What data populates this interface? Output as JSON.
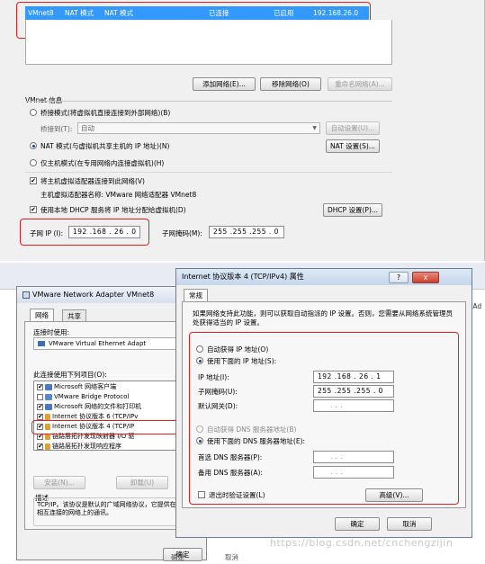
{
  "network_row": {
    "name": "VMnet8",
    "type": "NAT 模式",
    "external": "NAT 模式",
    "host_conn": "已连接",
    "dhcp": "已启用",
    "subnet": "192.168.26.0"
  },
  "network_buttons": {
    "add": "添加网络(E)...",
    "remove": "移除网络(O)",
    "rename": "重命名网络(A)..."
  },
  "vmnet_info": {
    "title": "VMnet 信息",
    "bridged_label": "桥接模式(将虚拟机直接连接到外部网络)(B)",
    "bridged_to_label": "桥接到(T):",
    "bridged_to_value": "自动",
    "auto_settings": "自动设置(U)...",
    "nat_label": "NAT 模式(与虚拟机共享主机的 IP 地址)(N)",
    "nat_settings": "NAT 设置(S)...",
    "hostonly_label": "仅主机模式(在专用网络内连接虚拟机)(H)",
    "connect_host_adapter": "将主机虚拟适配器连接到此网络(V)",
    "host_adapter_name": "主机虚拟适配器名称: VMware 网络适配器 VMnet8",
    "use_dhcp": "使用本地 DHCP 服务将 IP 地址分配给虚拟机(D)",
    "dhcp_settings": "DHCP 设置(P)...",
    "subnet_ip_label": "子网 IP (I):",
    "subnet_ip": "192 .168 . 26 . 0",
    "subnet_mask_label": "子网掩码(M):",
    "subnet_mask": "255 .255 .255 . 0"
  },
  "adapter_window": {
    "title": "VMware Network Adapter VMnet8",
    "tabs": [
      "网络",
      "共享"
    ],
    "connect_using": "连接时使用:",
    "adapter": "VMware Virtual Ethernet Adapt",
    "items_label": "此连接使用下列项目(O):",
    "items": [
      {
        "label": "Microsoft 网络客户端",
        "checked": true
      },
      {
        "label": "VMware Bridge Protocol",
        "checked": false
      },
      {
        "label": "Microsoft 网络的文件和打印机",
        "checked": true
      },
      {
        "label": "Internet 协议版本 6 (TCP/IPv",
        "checked": true
      },
      {
        "label": "Internet 协议版本 4 (TCP/IP",
        "checked": true
      },
      {
        "label": "链路层拓扑发现映射器 I/O 驱",
        "checked": true
      },
      {
        "label": "链路层拓扑发现响应程序",
        "checked": true
      }
    ],
    "install": "安装(N)...",
    "uninstall": "卸载(U)",
    "desc_title": "描述",
    "desc_text": "TCP/IP。该协议是默认的广域网络协议，它提供在不同的相互连接的网络上的通讯。",
    "ok": "确定",
    "cancel": "取消"
  },
  "ipv4_dialog": {
    "title": "Internet 协议版本 4 (TCP/IPv4) 属性",
    "tab": "常规",
    "intro": "如果网络支持此功能，则可以获取自动指派的 IP 设置。否则，您需要从网络系统管理员处获得适当的 IP 设置。",
    "auto_ip": "自动获得 IP 地址(O)",
    "manual_ip": "使用下面的 IP 地址(S):",
    "ip_label": "IP 地址(I):",
    "ip": "192 .168 . 26 . 1",
    "mask_label": "子网掩码(U):",
    "mask": "255 .255 .255 . 0",
    "gw_label": "默认网关(D):",
    "gw": ".      .      .",
    "auto_dns": "自动获得 DNS 服务器地址(B)",
    "manual_dns": "使用下面的 DNS 服务器地址(E):",
    "dns1_label": "首选 DNS 服务器(P):",
    "dns1": ".      .      .",
    "dns2_label": "备用 DNS 服务器(A):",
    "dns2": ".      .      .",
    "validate": "退出时验证设置(L)",
    "advanced": "高级(V)...",
    "ok": "确定",
    "cancel": "取消",
    "help": "?",
    "close": "x"
  },
  "bg_fragments": {
    "right_text": "ork Ad",
    "bottom_ok": "确定",
    "bottom_cancel": "取消"
  },
  "watermark": "https://blog.csdn.net/cnchengzijin"
}
